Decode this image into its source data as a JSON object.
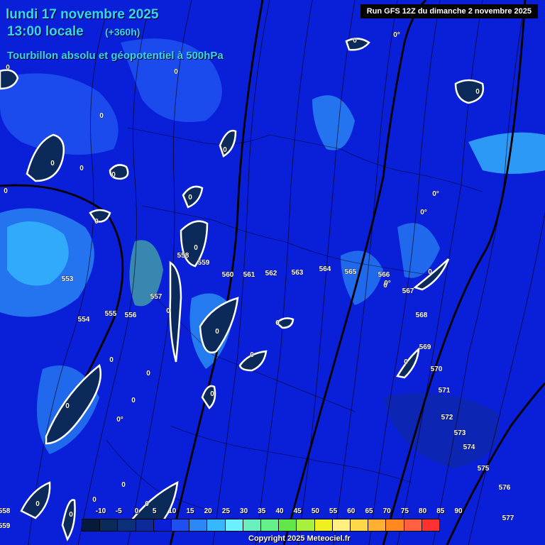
{
  "header": {
    "date": "lundi 17 novembre 2025",
    "time": "13:00 locale",
    "lead": "(+360h)",
    "subtitle": "Tourbillon absolu et géopotentiel à 500hPa",
    "run": "Run GFS 12Z du dimanche 2 novembre 2025"
  },
  "footer": {
    "copyright": "Copyright 2025 Meteociel.fr"
  },
  "colors": {
    "title": "#36d6ff",
    "background": "#0a1fd8",
    "contour": "#000000",
    "zero_line": "#ffffff"
  },
  "legend": {
    "ticks": [
      "-10",
      "-5",
      "0",
      "5",
      "10",
      "15",
      "20",
      "25",
      "30",
      "35",
      "40",
      "45",
      "50",
      "55",
      "60",
      "65",
      "70",
      "75",
      "80",
      "85",
      "90"
    ],
    "colors": [
      "#061a3a",
      "#0a2a5a",
      "#0c2f7a",
      "#0e2a9a",
      "#0a1fd8",
      "#1e50f0",
      "#2a88f5",
      "#36b8ff",
      "#6af0ff",
      "#6af0c0",
      "#66f08a",
      "#62e64a",
      "#a8f040",
      "#f0f020",
      "#fff080",
      "#ffd84a",
      "#ffb030",
      "#ff8820",
      "#ff6040",
      "#ff3030"
    ]
  },
  "geopotential_labels": [
    "553",
    "554",
    "555",
    "556",
    "557",
    "558",
    "559",
    "560",
    "561",
    "562",
    "563",
    "564",
    "565",
    "566",
    "567",
    "568",
    "569",
    "570",
    "571",
    "572",
    "573",
    "574",
    "575",
    "576",
    "577"
  ],
  "vorticity_labels": [
    "0",
    "0°"
  ]
}
